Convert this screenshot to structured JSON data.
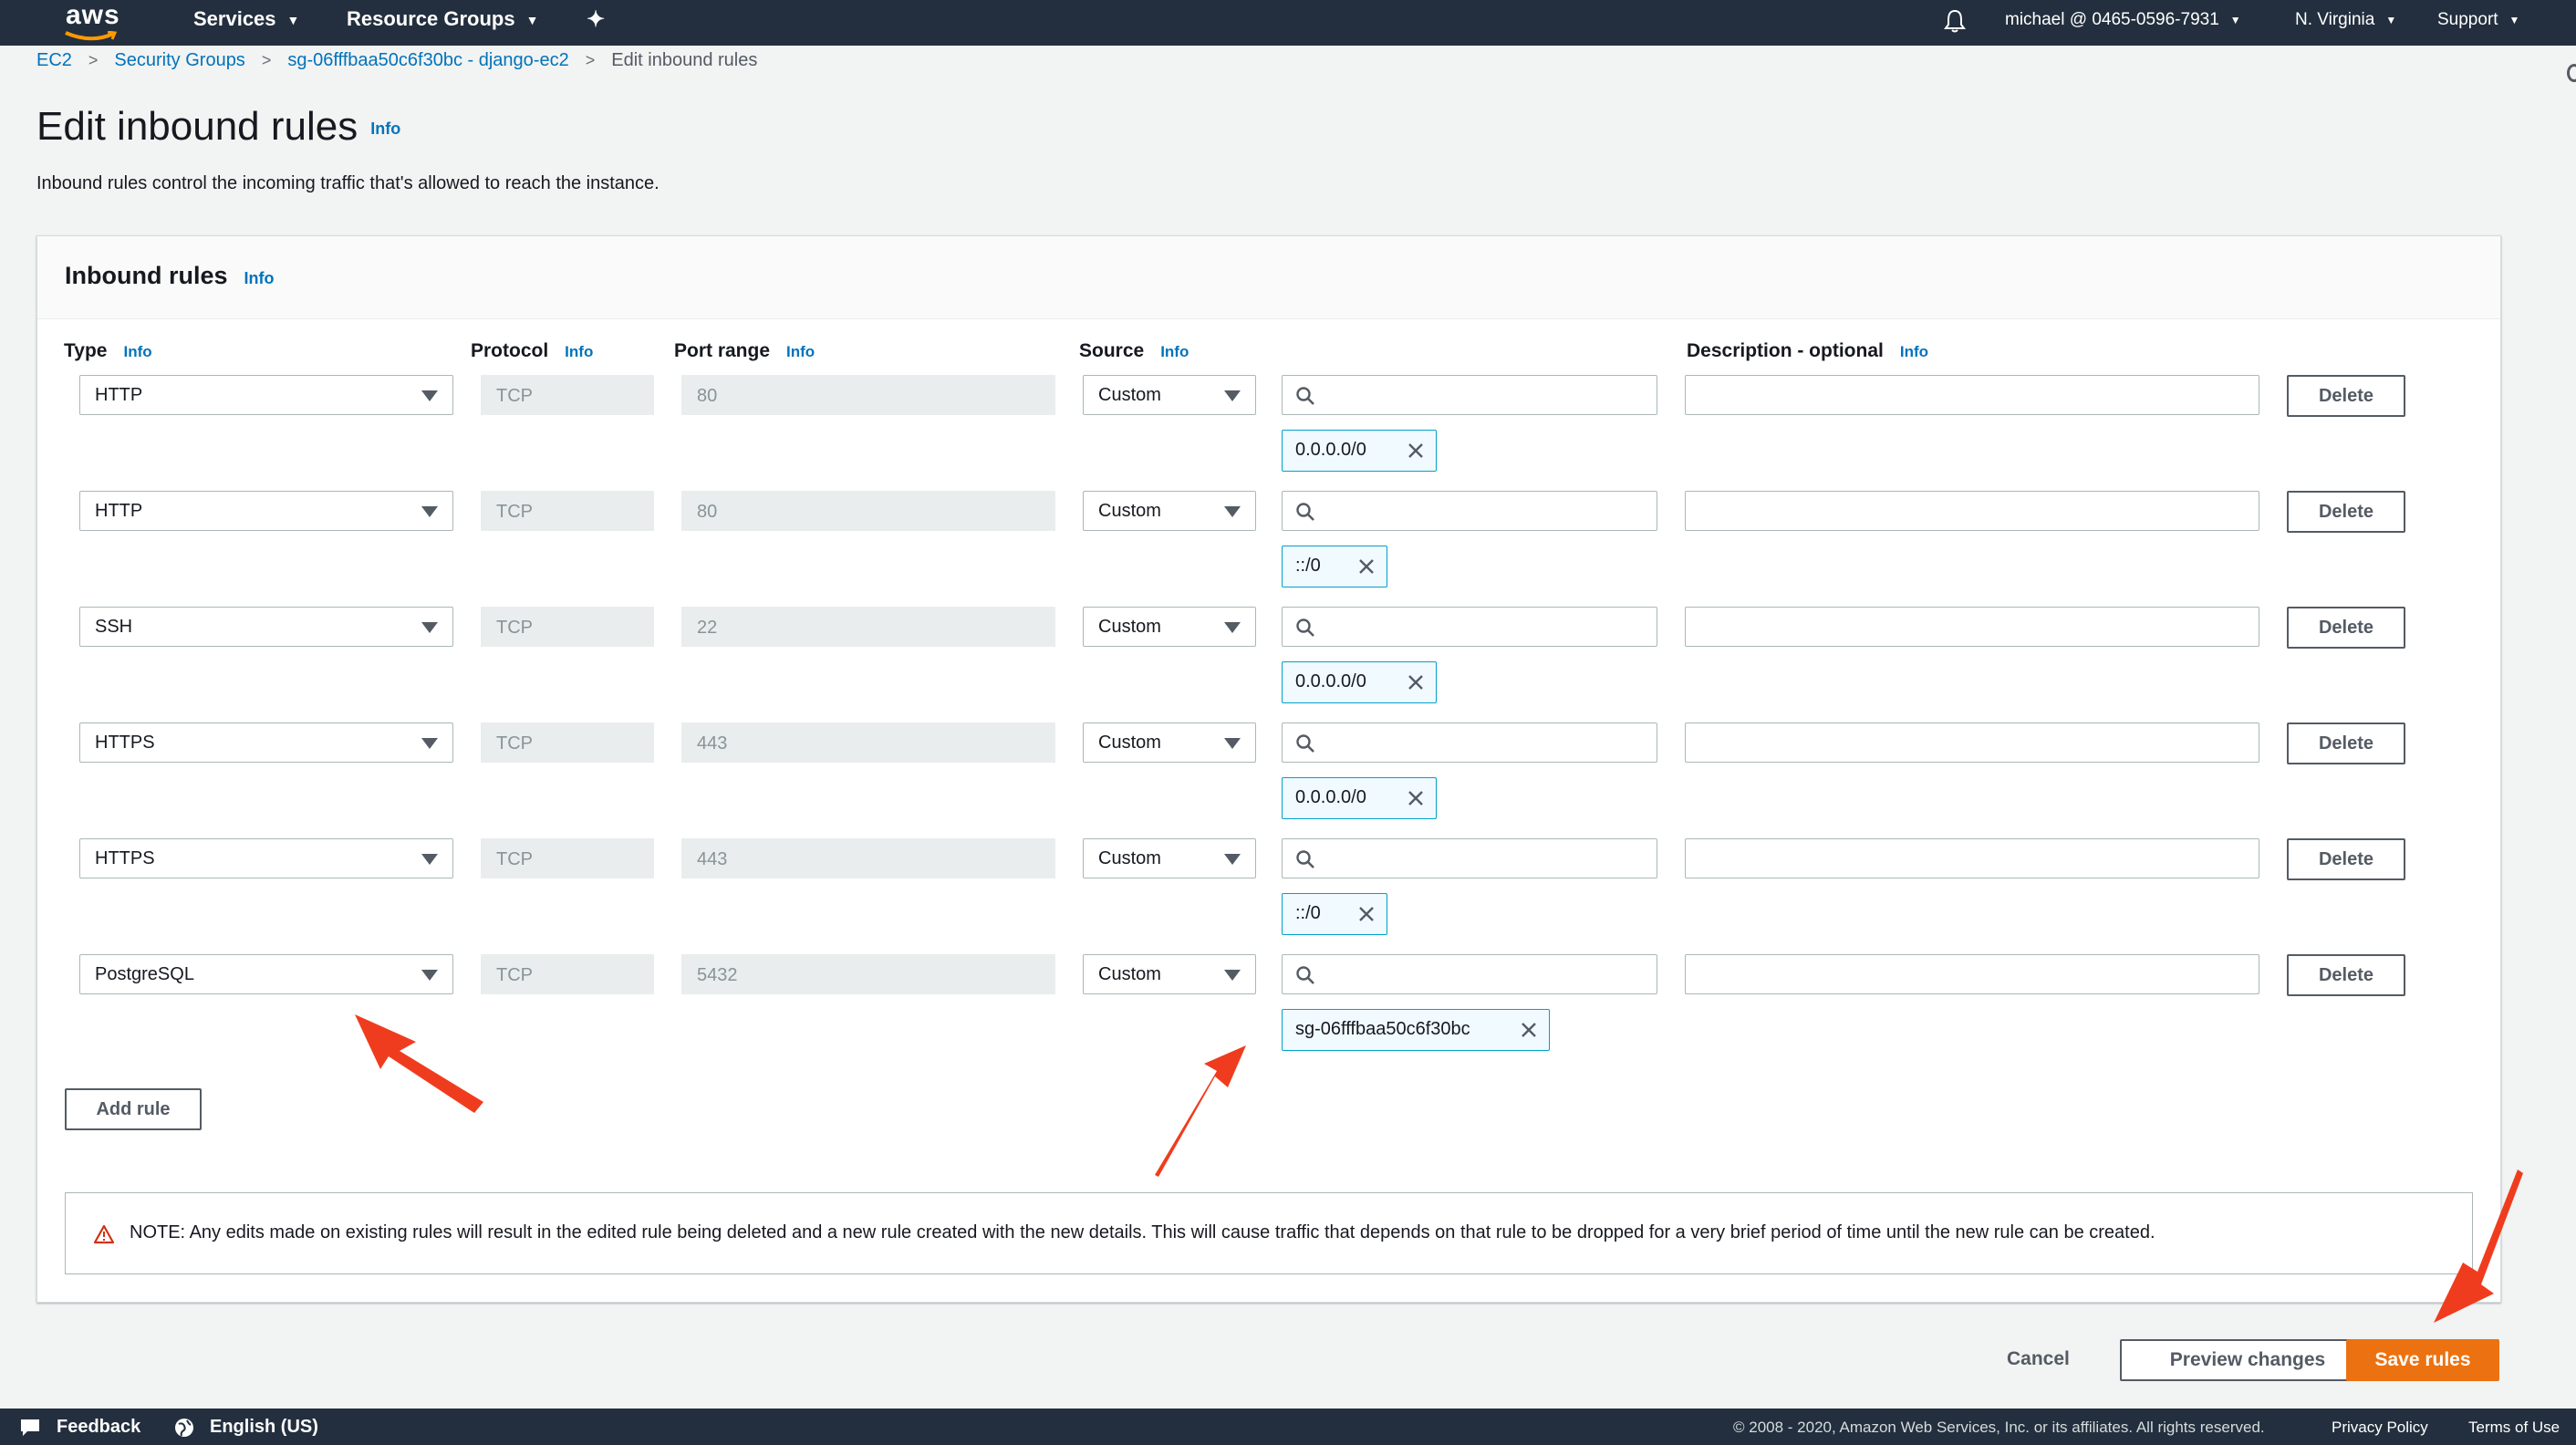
{
  "nav": {
    "logo": "aws",
    "services": "Services",
    "resource_groups": "Resource Groups",
    "account": "michael @ 0465-0596-7931",
    "region": "N. Virginia",
    "support": "Support"
  },
  "breadcrumb": {
    "items": [
      "EC2",
      "Security Groups",
      "sg-06fffbaa50c6f30bc - django-ec2"
    ],
    "current": "Edit inbound rules"
  },
  "page": {
    "title": "Edit inbound rules",
    "info": "Info",
    "description": "Inbound rules control the incoming traffic that's allowed to reach the instance."
  },
  "panel": {
    "title": "Inbound rules",
    "info": "Info",
    "columns": {
      "type": "Type",
      "protocol": "Protocol",
      "port_range": "Port range",
      "source": "Source",
      "description": "Description - optional"
    },
    "rules": [
      {
        "type": "HTTP",
        "protocol": "TCP",
        "port": "80",
        "source": "Custom",
        "cidr": "0.0.0.0/0",
        "delete": "Delete"
      },
      {
        "type": "HTTP",
        "protocol": "TCP",
        "port": "80",
        "source": "Custom",
        "cidr": "::/0",
        "delete": "Delete"
      },
      {
        "type": "SSH",
        "protocol": "TCP",
        "port": "22",
        "source": "Custom",
        "cidr": "0.0.0.0/0",
        "delete": "Delete"
      },
      {
        "type": "HTTPS",
        "protocol": "TCP",
        "port": "443",
        "source": "Custom",
        "cidr": "0.0.0.0/0",
        "delete": "Delete"
      },
      {
        "type": "HTTPS",
        "protocol": "TCP",
        "port": "443",
        "source": "Custom",
        "cidr": "::/0",
        "delete": "Delete"
      },
      {
        "type": "PostgreSQL",
        "protocol": "TCP",
        "port": "5432",
        "source": "Custom",
        "cidr": "sg-06fffbaa50c6f30bc",
        "delete": "Delete"
      }
    ],
    "add_rule": "Add rule",
    "note": "NOTE: Any edits made on existing rules will result in the edited rule being deleted and a new rule created with the new details. This will cause traffic that depends on that rule to be dropped for a very brief period of time until the new rule can be created."
  },
  "actions": {
    "cancel": "Cancel",
    "preview": "Preview changes",
    "save": "Save rules"
  },
  "footer": {
    "feedback": "Feedback",
    "language": "English (US)",
    "copyright": "© 2008 - 2020, Amazon Web Services, Inc. or its affiliates. All rights reserved.",
    "privacy": "Privacy Policy",
    "terms": "Terms of Use"
  },
  "colors": {
    "nav_bg": "#232f3e",
    "link": "#0073bb",
    "primary": "#ec7211",
    "annotation_arrow": "#f03c1e",
    "token_border": "#00a1c9",
    "warning": "#d13212"
  }
}
